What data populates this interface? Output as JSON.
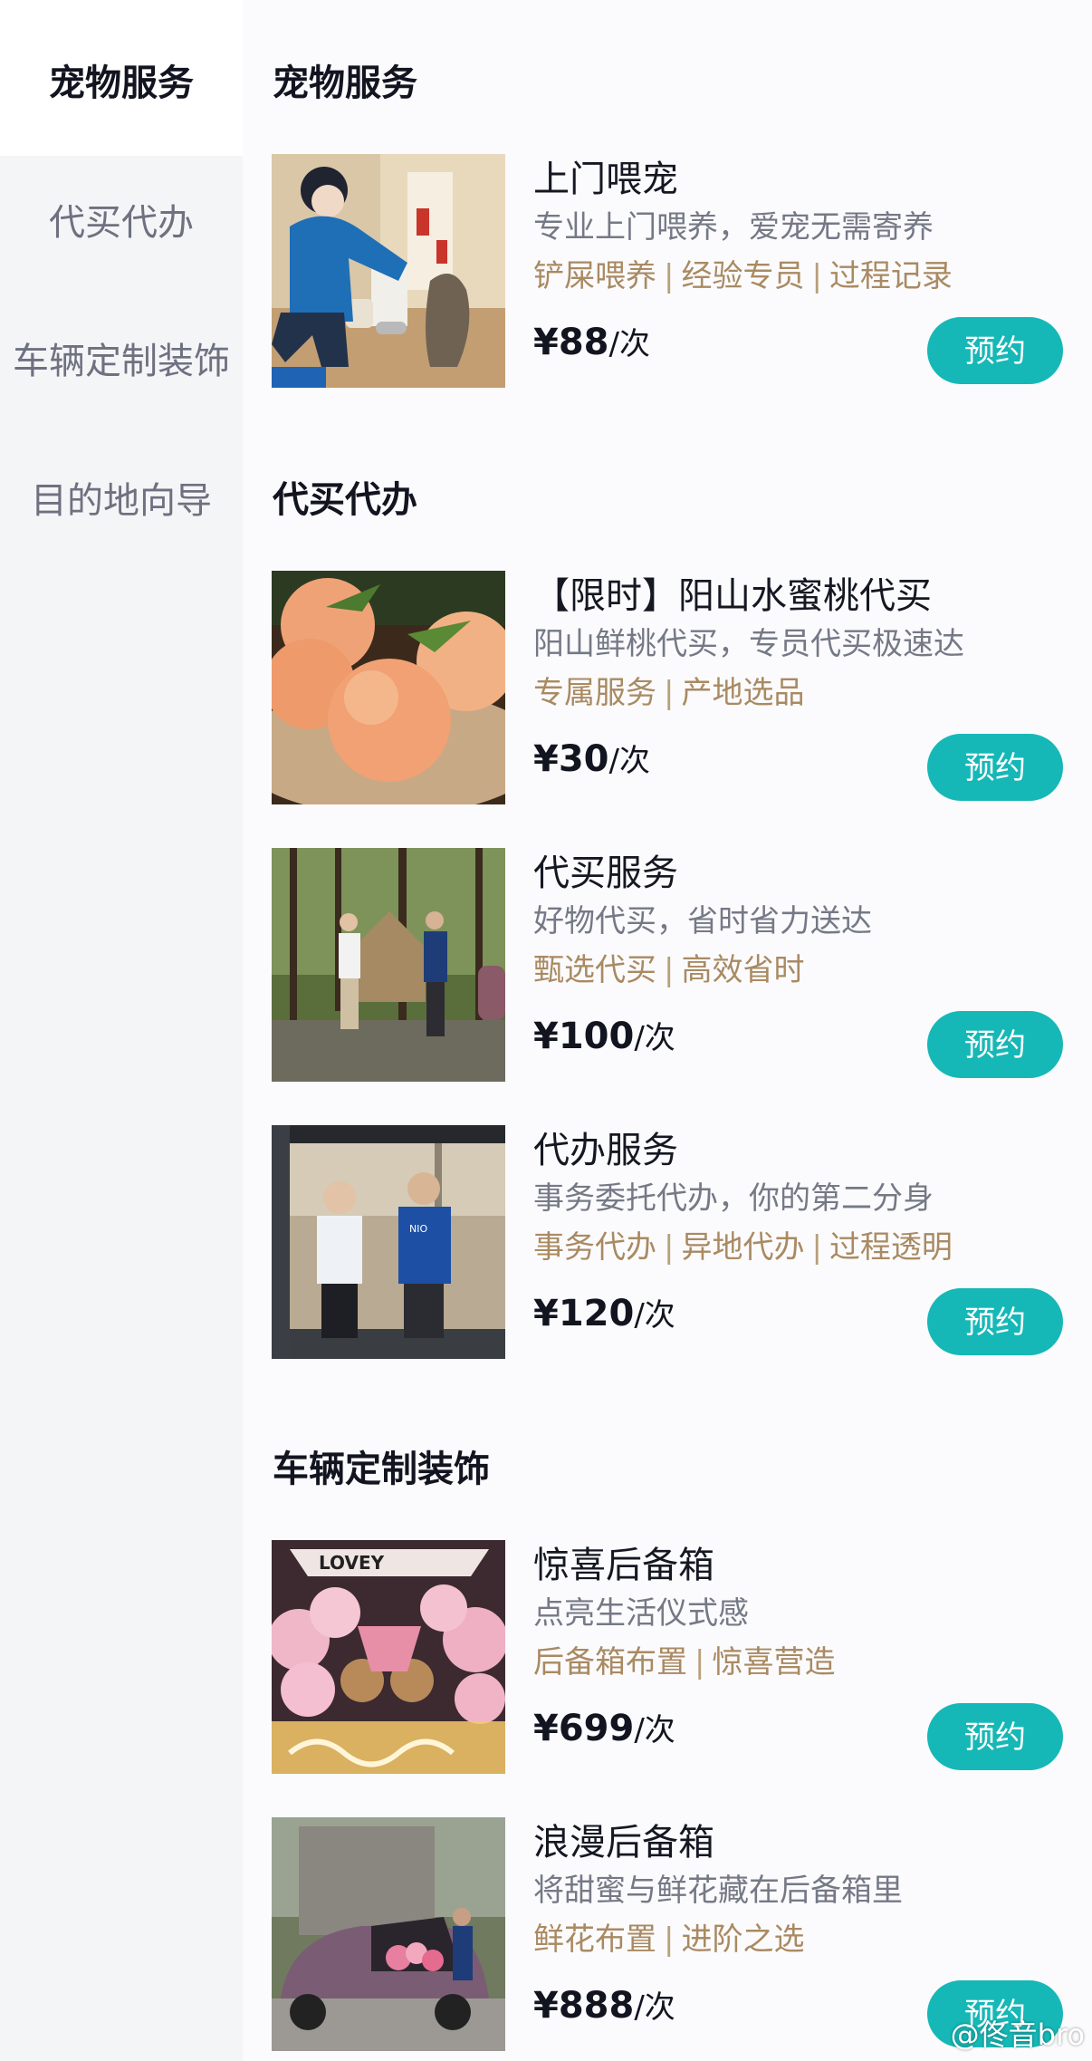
{
  "sidebar": {
    "items": [
      {
        "label": "宠物服务",
        "active": true
      },
      {
        "label": "代买代办",
        "active": false
      },
      {
        "label": "车辆定制装饰",
        "active": false
      },
      {
        "label": "目的地向导",
        "active": false
      }
    ]
  },
  "sections": [
    {
      "title": "宠物服务",
      "cards": [
        {
          "title": "上门喂宠",
          "desc": "专业上门喂养，爱宠无需寄养",
          "tags": [
            "铲屎喂养",
            "经验专员",
            "过程记录"
          ],
          "price": "¥88",
          "unit": "/次",
          "button": "预约"
        }
      ]
    },
    {
      "title": "代买代办",
      "cards": [
        {
          "title": "【限时】阳山水蜜桃代买",
          "desc": "阳山鲜桃代买，专员代买极速达",
          "tags": [
            "专属服务",
            "产地选品"
          ],
          "price": "¥30",
          "unit": "/次",
          "button": "预约"
        },
        {
          "title": "代买服务",
          "desc": "好物代买，省时省力送达",
          "tags": [
            "甄选代买",
            "高效省时"
          ],
          "price": "¥100",
          "unit": "/次",
          "button": "预约"
        },
        {
          "title": "代办服务",
          "desc": "事务委托代办，你的第二分身",
          "tags": [
            "事务代办",
            "异地代办",
            "过程透明"
          ],
          "price": "¥120",
          "unit": "/次",
          "button": "预约"
        }
      ]
    },
    {
      "title": "车辆定制装饰",
      "cards": [
        {
          "title": "惊喜后备箱",
          "desc": "点亮生活仪式感",
          "tags": [
            "后备箱布置",
            "惊喜营造"
          ],
          "price": "¥699",
          "unit": "/次",
          "button": "预约"
        },
        {
          "title": "浪漫后备箱",
          "desc": "将甜蜜与鲜花藏在后备箱里",
          "tags": [
            "鲜花布置",
            "进阶之选"
          ],
          "price": "¥888",
          "unit": "/次",
          "button": "预约"
        }
      ]
    }
  ],
  "photo_badges": {
    "nio_shirt": "NIO",
    "balloon_letters": "LOVEY"
  },
  "watermark": "@佟音bro",
  "colors": {
    "accent": "#16b8b7",
    "tag": "#a98a62",
    "sidebar_bg": "#f4f5f7"
  }
}
